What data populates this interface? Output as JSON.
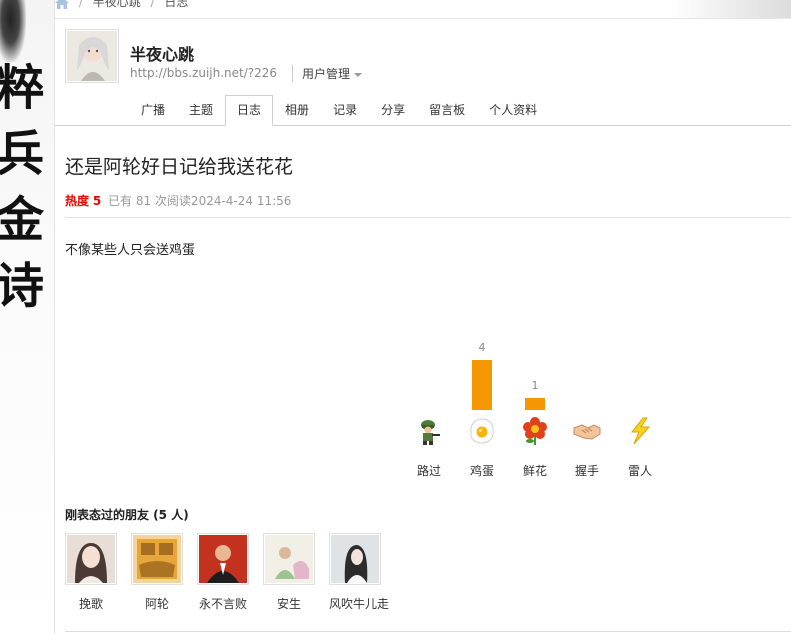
{
  "breadcrumb": {
    "items": [
      "半夜心跳",
      "日志"
    ]
  },
  "space": {
    "name": "半夜心跳",
    "url": "http://bbs.zuijh.net/?226",
    "manage_label": "用户管理"
  },
  "tabs": [
    {
      "label": "广播"
    },
    {
      "label": "主题"
    },
    {
      "label": "日志",
      "active": true
    },
    {
      "label": "相册"
    },
    {
      "label": "记录"
    },
    {
      "label": "分享"
    },
    {
      "label": "留言板"
    },
    {
      "label": "个人资料"
    }
  ],
  "article": {
    "title": "还是阿轮好日记给我送花花",
    "hot_label": "热度",
    "hot_value": "5",
    "views_text": "已有 81 次阅读2024-4-24 11:56",
    "body": "不像某些人只会送鸡蛋"
  },
  "votes": [
    {
      "label": "路过",
      "count": 0,
      "count_text": "",
      "icon": "soldier-icon"
    },
    {
      "label": "鸡蛋",
      "count": 4,
      "count_text": "4",
      "icon": "egg-icon"
    },
    {
      "label": "鲜花",
      "count": 1,
      "count_text": "1",
      "icon": "flower-icon"
    },
    {
      "label": "握手",
      "count": 0,
      "count_text": "",
      "icon": "handshake-icon"
    },
    {
      "label": "雷人",
      "count": 0,
      "count_text": "",
      "icon": "lightning-icon"
    }
  ],
  "vote_color": "#f59800",
  "friends": {
    "title": "刚表态过的朋友 (5 人)",
    "items": [
      {
        "name": "挽歌"
      },
      {
        "name": "阿轮"
      },
      {
        "name": "永不言败"
      },
      {
        "name": "安生"
      },
      {
        "name": "风吹牛儿走"
      }
    ]
  },
  "side_art": {
    "glyphs": [
      "粹",
      "兵",
      "金",
      "诗"
    ]
  }
}
